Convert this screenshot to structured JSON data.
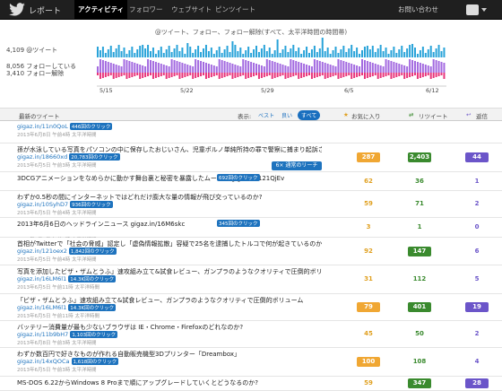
{
  "topbar": {
    "brand": "レポート",
    "tabs": [
      "アクティビティ",
      "フォロワー",
      "ウェブサイト",
      "ピンツイート"
    ],
    "inquiry": "お問い合わせ"
  },
  "chart_data": {
    "type": "bar",
    "title": "@ツイート、フォロー、フォロー解除(すべて、太平洋時間の時間帯)",
    "series": [
      {
        "name": "@ツイート",
        "label": "4,109 @ツイート",
        "total": 4109,
        "color": "#29a3d9"
      },
      {
        "name": "フォローしている",
        "label": "8,056 フォローしている",
        "total": 8056,
        "color": "#a36ae0"
      },
      {
        "name": "フォロー解除",
        "label": "3,410 フォロー解除",
        "total": 3410,
        "color": "#e8357a"
      }
    ],
    "x_ticks": [
      "5/15",
      "5/22",
      "5/29",
      "6/5",
      "6/12"
    ]
  },
  "table": {
    "header": {
      "recent": "最新のツイート",
      "show": "表示:",
      "filters": [
        "ベスト",
        "良い",
        "すべて"
      ],
      "fav": "お気に入り",
      "rt": "リツイート",
      "reply": "返信"
    },
    "rows": [
      {
        "text": "",
        "link": "gigaz.in/11n0QoL",
        "clicks": "446回のクリック",
        "time": "2013年6月8日 午前4時 太平洋時間",
        "fav": "",
        "rt": "",
        "reply": ""
      },
      {
        "text": "孫が水泳している写真をパソコンの中に保存したおじいさん、児童ポルノ単純所持の罪で警察に捕まり起訴される",
        "link": "gigaz.in/18660xd",
        "clicks": "20,783回のクリック",
        "time": "2013年6月5日 午前3時 太平洋時間",
        "fav": "287",
        "favFill": true,
        "rt": "2,403",
        "rtFill": true,
        "reply": "44",
        "replyFill": true,
        "reach": "6× 通常のリーチ"
      },
      {
        "text": "3DCGアニメーションをなめらかに動かす舞台裏と秘密を暴露したムービー gigaz.in/121QjEv",
        "link": "",
        "clicks": "692回のクリック",
        "time": "2013年6月5日 午前4時 太平洋時間",
        "fav": "62",
        "rt": "36",
        "reply": "1"
      },
      {
        "text": "わずか0.5秒の間にインターネットではどれだけ膨大な量の情報が飛び交っているのか?",
        "link": "gigaz.in/10SyhD7",
        "clicks": "936回のクリック",
        "time": "2013年6月5日 午前4時 太平洋時間",
        "fav": "59",
        "rt": "71",
        "reply": "2"
      },
      {
        "text": "2013年6月6日のヘッドラインニュース gigaz.in/16M6skc",
        "link": "",
        "clicks": "345回のクリック",
        "time": "2013年6月6日 午前7時 太平洋時間",
        "fav": "3",
        "rt": "1",
        "reply": "0"
      },
      {
        "text": "首相がTwitterで「社会の脅威」認定し「虚偽情報拡散」容疑で25名を逮捕したトルコで何が起きているのかまとめ",
        "link": "gigaz.in/121oex2",
        "clicks": "1,842回のクリック",
        "time": "2013年6月5日 午前4時 太平洋時間",
        "fav": "92",
        "rt": "147",
        "rtFill": true,
        "reply": "6"
      },
      {
        "text": "写真を添加したビザ・ザムとうふ」速攻組み立て&試食レビュー、ガンプラのようなクオリティで圧倒的ボリューム",
        "link": "gigaz.in/16LM6l1",
        "clicks": "14.3K回のクリック",
        "time": "2013年6月5日 午前11時 太平洋時間",
        "fav": "31",
        "rt": "112",
        "reply": "5"
      },
      {
        "text": "「ビザ・ザムとうふ」速攻組み立て&試食レビュー、ガンプラのようなクオリティで圧倒的ボリューム",
        "link": "gigaz.in/16LM6l1",
        "clicks": "14.3K回のクリック",
        "time": "2013年6月5日 午前11時 太平洋時間",
        "fav": "79",
        "favFill": true,
        "rt": "401",
        "rtFill": true,
        "reply": "19",
        "replyFill": true
      },
      {
        "text": "バッテリー消費量が最も少ないブラウザは IE・Chrome・Firefoxのどれなのか?",
        "link": "gigaz.in/11b9bH7",
        "clicks": "1,103回のクリック",
        "time": "2013年6月8日 午前3時 太平洋時間",
        "fav": "45",
        "rt": "50",
        "reply": "2"
      },
      {
        "text": "わずか数百円で好きなものが作れる自動販売機型3Dプリンター「Dreambox」",
        "link": "gigaz.in/14xQOCa",
        "clicks": "1,618回のクリック",
        "time": "2013年6月5日 午前3時 太平洋時間",
        "fav": "100",
        "favFill": true,
        "rt": "108",
        "reply": "4"
      },
      {
        "text": "MS-DOS 6.22からWindows 8 Proまで順にアップグレードしていくとどうなるのか?",
        "link": "",
        "clicks": "",
        "time": "",
        "fav": "59",
        "rt": "347",
        "rtFill": true,
        "reply": "28",
        "replyFill": true
      }
    ]
  }
}
